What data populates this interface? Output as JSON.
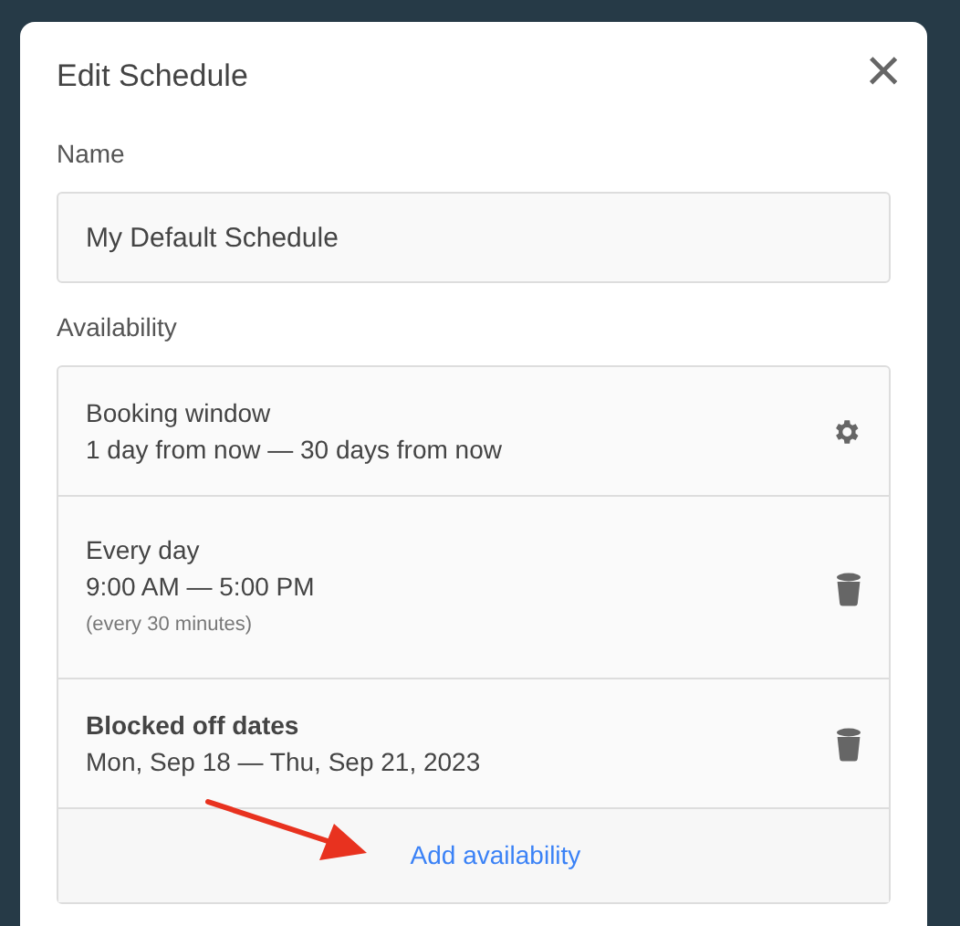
{
  "dialog": {
    "title": "Edit Schedule",
    "close": "×"
  },
  "name_field": {
    "label": "Name",
    "value": "My Default Schedule"
  },
  "availability": {
    "label": "Availability",
    "items": [
      {
        "kind": "window",
        "title": "Booking window",
        "detail": "1 day from now — 30 days from now"
      },
      {
        "kind": "rule",
        "title": "Every day",
        "detail": "9:00 AM — 5:00 PM",
        "note": "(every 30 minutes)"
      },
      {
        "kind": "blocked",
        "title": "Blocked off dates",
        "detail": "Mon, Sep 18 — Thu, Sep 21, 2023"
      }
    ],
    "add_link": "Add availability"
  }
}
